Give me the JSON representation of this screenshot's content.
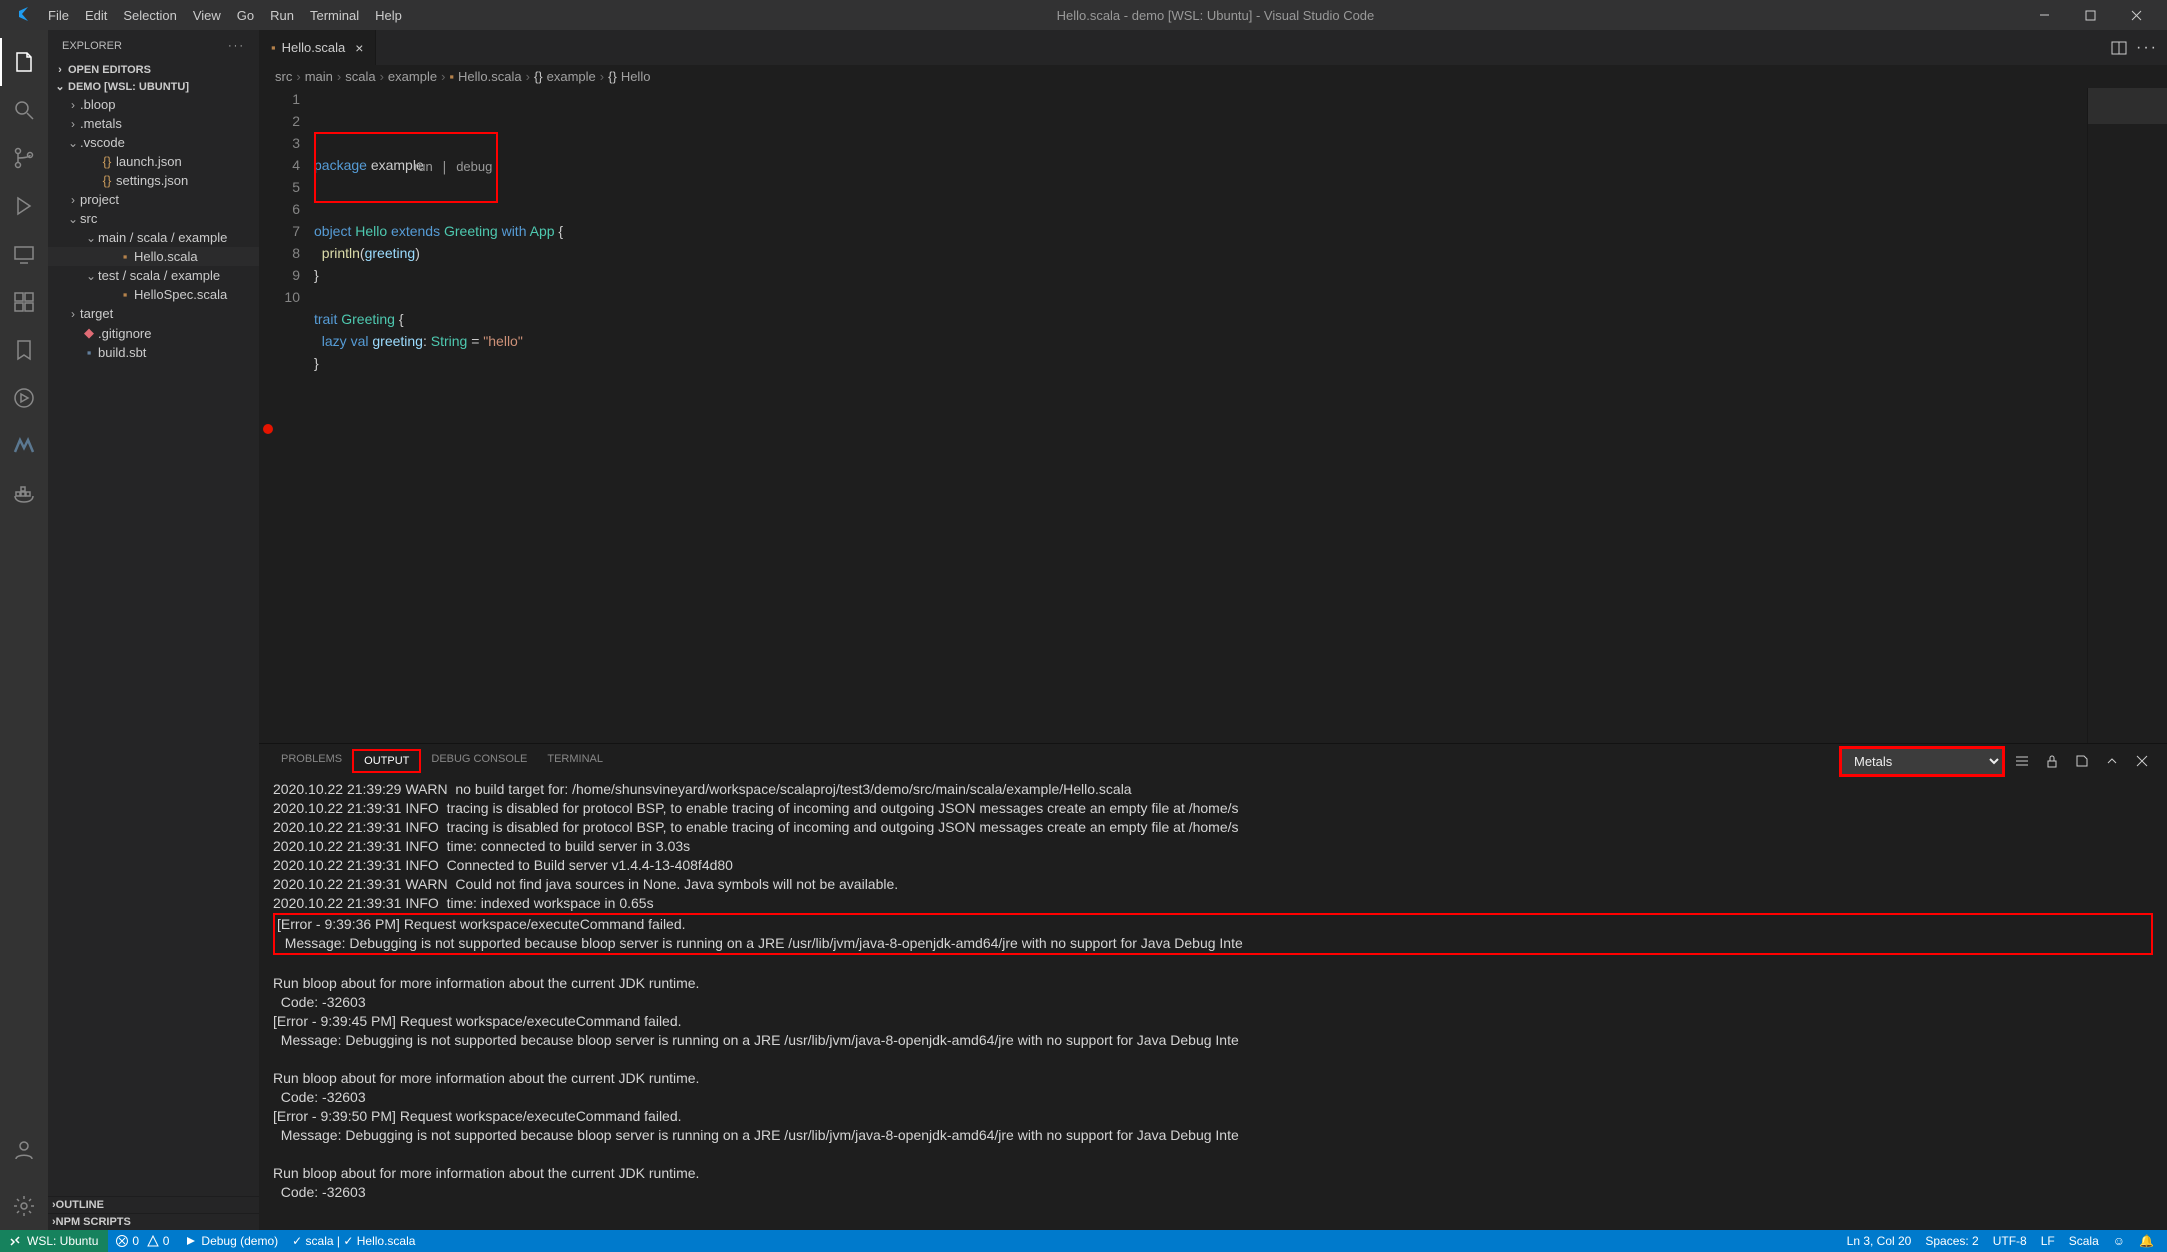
{
  "titlebar": {
    "menu": [
      "File",
      "Edit",
      "Selection",
      "View",
      "Go",
      "Run",
      "Terminal",
      "Help"
    ],
    "title": "Hello.scala - demo [WSL: Ubuntu] - Visual Studio Code"
  },
  "sidebar": {
    "title": "EXPLORER",
    "open_editors_label": "OPEN EDITORS",
    "root_label": "DEMO [WSL: UBUNTU]",
    "tree": [
      {
        "indent": 18,
        "chev": "›",
        "label": ".bloop"
      },
      {
        "indent": 18,
        "chev": "›",
        "label": ".metals"
      },
      {
        "indent": 18,
        "chev": "⌄",
        "label": ".vscode"
      },
      {
        "indent": 36,
        "icon": "{}",
        "color": "#c5985b",
        "label": "launch.json"
      },
      {
        "indent": 36,
        "icon": "{}",
        "color": "#c5985b",
        "label": "settings.json"
      },
      {
        "indent": 18,
        "chev": "›",
        "label": "project"
      },
      {
        "indent": 18,
        "chev": "⌄",
        "label": "src"
      },
      {
        "indent": 36,
        "chev": "⌄",
        "label": "main / scala / example"
      },
      {
        "indent": 54,
        "icon": "▪",
        "color": "#b5824b",
        "label": "Hello.scala",
        "hl": true
      },
      {
        "indent": 36,
        "chev": "⌄",
        "label": "test / scala / example"
      },
      {
        "indent": 54,
        "icon": "▪",
        "color": "#b5824b",
        "label": "HelloSpec.scala"
      },
      {
        "indent": 18,
        "chev": "›",
        "label": "target"
      },
      {
        "indent": 18,
        "icon": "◆",
        "color": "#e06c75",
        "label": ".gitignore"
      },
      {
        "indent": 18,
        "icon": "▪",
        "color": "#627f9c",
        "label": "build.sbt"
      }
    ],
    "outline_label": "OUTLINE",
    "npm_label": "NPM SCRIPTS"
  },
  "tabs": {
    "open": [
      {
        "label": "Hello.scala"
      }
    ]
  },
  "breadcrumbs": {
    "items": [
      "src",
      "main",
      "scala",
      "example",
      "Hello.scala",
      "example",
      "Hello"
    ]
  },
  "codelens": {
    "run": "run",
    "debug": "debug"
  },
  "code": {
    "lines": [
      {
        "n": 1,
        "html": "<span class='kw'>package</span> example"
      },
      {
        "n": 2,
        "html": ""
      },
      {
        "n": "",
        "html": ""
      },
      {
        "n": 3,
        "html": "<span class='kw'>object</span> <span class='tp'>Hello</span> <span class='kw'>extends</span> <span class='tp'>Greeting</span> <span class='kw'>with</span> <span class='tp'>App</span> {"
      },
      {
        "n": 4,
        "html": "  <span class='fn'>println</span>(<span class='id'>greeting</span>)"
      },
      {
        "n": 5,
        "html": "}"
      },
      {
        "n": 6,
        "html": ""
      },
      {
        "n": 7,
        "html": "<span class='kw'>trait</span> <span class='tp'>Greeting</span> {"
      },
      {
        "n": 8,
        "html": "  <span class='kw'>lazy</span> <span class='kw'>val</span> <span class='id'>greeting</span>: <span class='tp'>String</span> = <span class='str'>\"hello\"</span>",
        "bp": true
      },
      {
        "n": 9,
        "html": "}"
      },
      {
        "n": 10,
        "html": ""
      }
    ]
  },
  "panel": {
    "tabs": [
      "PROBLEMS",
      "OUTPUT",
      "DEBUG CONSOLE",
      "TERMINAL"
    ],
    "active_tab": "OUTPUT",
    "channel": "Metals",
    "body_lines": [
      {
        "t": "2020.10.22 21:39:29 WARN  no build target for: /home/shunsvineyard/workspace/scalaproj/test3/demo/src/main/scala/example/Hello.scala"
      },
      {
        "t": "2020.10.22 21:39:31 INFO  tracing is disabled for protocol BSP, to enable tracing of incoming and outgoing JSON messages create an empty file at /home/s"
      },
      {
        "t": "2020.10.22 21:39:31 INFO  tracing is disabled for protocol BSP, to enable tracing of incoming and outgoing JSON messages create an empty file at /home/s"
      },
      {
        "t": "2020.10.22 21:39:31 INFO  time: connected to build server in 3.03s"
      },
      {
        "t": "2020.10.22 21:39:31 INFO  Connected to Build server v1.4.4-13-408f4d80"
      },
      {
        "t": "2020.10.22 21:39:31 WARN  Could not find java sources in None. Java symbols will not be available."
      },
      {
        "t": "2020.10.22 21:39:31 INFO  time: indexed workspace in 0.65s"
      },
      {
        "hl": true,
        "t": "[Error - 9:39:36 PM] Request workspace/executeCommand failed.\n  Message: Debugging is not supported because bloop server is running on a JRE /usr/lib/jvm/java-8-openjdk-amd64/jre with no support for Java Debug Inte"
      },
      {
        "t": ""
      },
      {
        "t": "Run bloop about for more information about the current JDK runtime."
      },
      {
        "t": "  Code: -32603"
      },
      {
        "t": "[Error - 9:39:45 PM] Request workspace/executeCommand failed."
      },
      {
        "t": "  Message: Debugging is not supported because bloop server is running on a JRE /usr/lib/jvm/java-8-openjdk-amd64/jre with no support for Java Debug Inte"
      },
      {
        "t": ""
      },
      {
        "t": "Run bloop about for more information about the current JDK runtime."
      },
      {
        "t": "  Code: -32603"
      },
      {
        "t": "[Error - 9:39:50 PM] Request workspace/executeCommand failed."
      },
      {
        "t": "  Message: Debugging is not supported because bloop server is running on a JRE /usr/lib/jvm/java-8-openjdk-amd64/jre with no support for Java Debug Inte"
      },
      {
        "t": ""
      },
      {
        "t": "Run bloop about for more information about the current JDK runtime."
      },
      {
        "t": "  Code: -32603"
      }
    ]
  },
  "statusbar": {
    "remote": "WSL: Ubuntu",
    "errors": "0",
    "warnings": "0",
    "debug": "Debug  (demo)",
    "scala": "scala",
    "file": "Hello.scala",
    "lncol": "Ln 3, Col 20",
    "spaces": "Spaces: 2",
    "encoding": "UTF-8",
    "eol": "LF",
    "lang": "Scala",
    "feedback": "☺",
    "bell": "🔔"
  }
}
